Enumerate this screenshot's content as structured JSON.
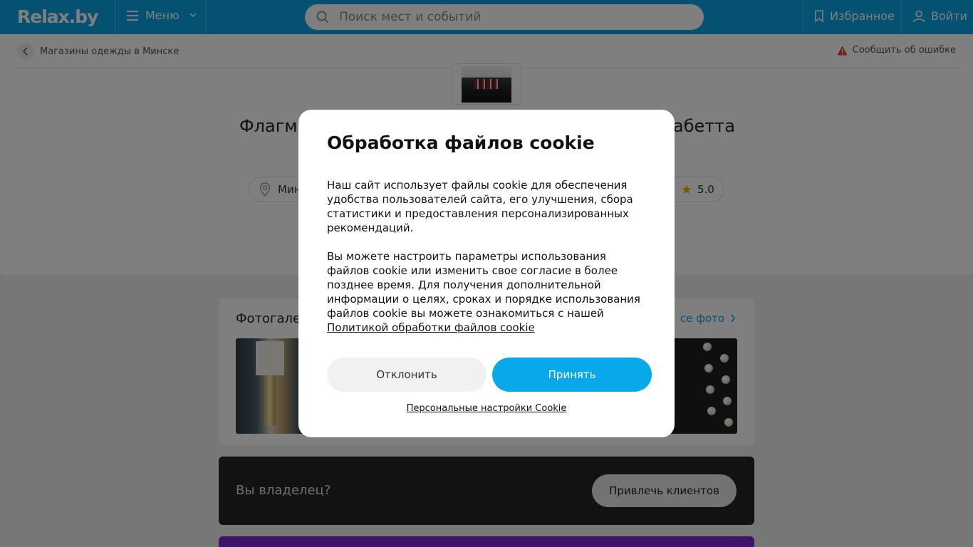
{
  "header": {
    "logo": "Relax.by",
    "menu_label": "Меню",
    "search_placeholder": "Поиск мест и событий",
    "favorites_label": "Избранное",
    "login_label": "Войти",
    "brand_color": "#0aa3e3"
  },
  "page": {
    "breadcrumb": "Магазины одежды в Минске",
    "report_error": "Сообщить об ошибке",
    "title_visible_left": "Флагм",
    "title_visible_right": "абетта",
    "address_partial": "Мин",
    "rating": "5.0"
  },
  "gallery": {
    "title": "Фотогале",
    "all_photos": "се фото"
  },
  "owner": {
    "text": "Вы владелец?",
    "button": "Привлечь клиентов"
  },
  "cookie_modal": {
    "title": "Обработка файлов cookie",
    "paragraph1": "Наш сайт использует файлы cookie для обеспечения удобства пользователей сайта, его улучшения, сбора статистики и предоставления персонализированных рекомендаций.",
    "paragraph2": "Вы можете настроить параметры использования файлов cookie или изменить свое согласие в более позднее время. Для получения дополнительной информации о целях, сроках и порядке использования файлов cookie вы можете ознакомиться с нашей",
    "policy_link": "Политикой обработки файлов cookie",
    "decline_button": "Отклонить",
    "accept_button": "Принять",
    "settings_link": "Персональные настройки Cookie",
    "accept_color": "#08a8ea"
  }
}
